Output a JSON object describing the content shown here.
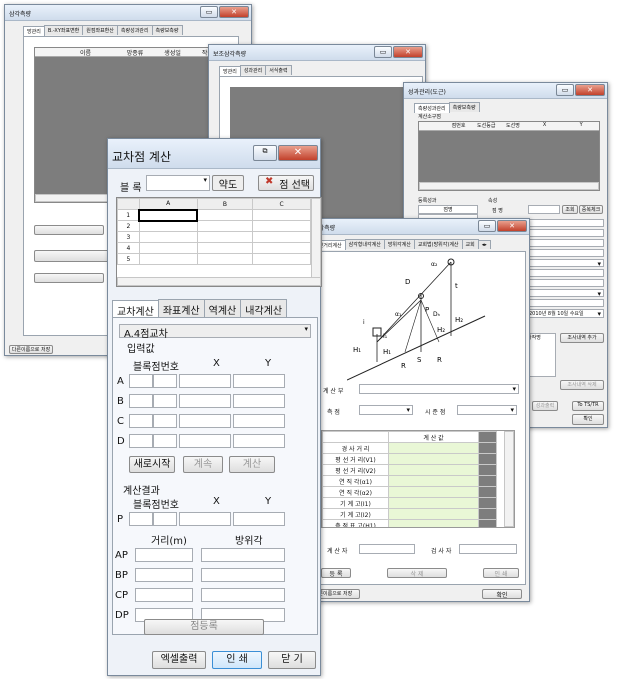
{
  "win1": {
    "title": "삼각측량",
    "tabs": [
      "망관리",
      "B.-XY좌표변환",
      "원점좌표환산",
      "측량성과관리",
      "측량보측량"
    ],
    "cols": [
      "이름",
      "망종류",
      "생성일",
      "작성자"
    ],
    "save": "다른이름으로 저장",
    "btn_side": "편",
    "tabs_more": "",
    "left_btn": ""
  },
  "win2": {
    "title": "보조삼각측량",
    "tabs": [
      "망관리",
      "성과관리",
      "서식출력"
    ]
  },
  "win3": {
    "title": "성과관리(도근)",
    "tabs": [
      "측량성과관리",
      "측량보측량"
    ],
    "sub": "계산소구점",
    "cols": [
      "점번호",
      "도선등급",
      "도선명",
      "X",
      "Y"
    ],
    "grp1": "등록성과",
    "grp2": "속성",
    "c1": "점명",
    "c2": "점 명",
    "btn_search": "조회",
    "btn_dup": "중복체크",
    "date": "2010년 8월 10일 수요일",
    "btn_add": "조사내역 추가",
    "btn_del": "조사내역 삭제",
    "btn_out": "성과출력",
    "btn_ts": "To TS/TR",
    "btn_ok": "확인",
    "small": "사작명"
  },
  "win4": {
    "title": "보조삼각측량",
    "tabs": [
      "평면거리계산",
      "삼각형내각계산",
      "방위각계산",
      "교회법(방위각)계산",
      "교회"
    ],
    "calc_label": "계 산 부",
    "meas": "측 점",
    "view": "시 준 점",
    "tbl_header": "계 산 값",
    "rows": [
      "경 사 거 리",
      "평 선 거 리(V1)",
      "평 선 거 리(V2)",
      "연 직 각(α1)",
      "연 직 각(α2)",
      "기 계 고(I1)",
      "기 계 고(I2)",
      "측 점 표 고(H1)"
    ],
    "calcer": "계 산 자",
    "checker": "검 사 자",
    "reg": "등 록",
    "mod": "삭 제",
    "print": "인 쇄",
    "save": "다른이름으로 저장",
    "ok": "확인",
    "fig": {
      "a1": "α₁",
      "a2": "α₂",
      "D": "D",
      "Dh": "Dₕ",
      "P": "P",
      "t": "t",
      "H1": "H₁",
      "H2": "H₂",
      "R": "R",
      "S": "S",
      "i": "i",
      "I1": "I₁"
    }
  },
  "win5": {
    "title": "교차점 계산",
    "block": "블 록",
    "fig_btn": "약도",
    "pick": "점 선택",
    "cols": [
      "A",
      "B",
      "C"
    ],
    "rows": [
      "1",
      "2",
      "3",
      "4",
      "5"
    ],
    "tabs": [
      "교차계산",
      "좌표계산",
      "역계산",
      "내각계산"
    ],
    "method": "A.4점교차",
    "input": "입력값",
    "hdr": [
      "블록점번호",
      "X",
      "Y"
    ],
    "pts": [
      "A",
      "B",
      "C",
      "D"
    ],
    "start": "새로시작",
    "cont": "계속",
    "calc": "계산",
    "result": "계산결과",
    "hdr2": [
      "블록점번호",
      "X",
      "Y"
    ],
    "p": "P",
    "hdr3": [
      "거리(m)",
      "방위각"
    ],
    "dist": [
      "AP",
      "BP",
      "CP",
      "DP"
    ],
    "reg": "점등록",
    "excel": "엑셀출력",
    "print": "인 쇄",
    "close": "닫 기"
  }
}
